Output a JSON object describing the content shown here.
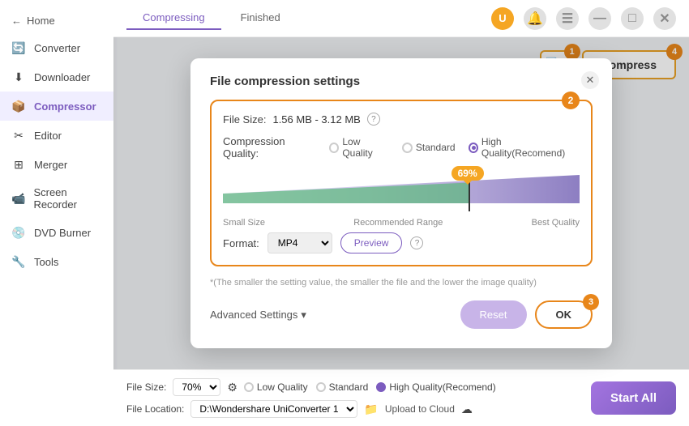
{
  "sidebar": {
    "back_label": "Home",
    "items": [
      {
        "id": "converter",
        "label": "Converter",
        "icon": "🔄",
        "active": false
      },
      {
        "id": "downloader",
        "label": "Downloader",
        "icon": "⬇",
        "active": false
      },
      {
        "id": "compressor",
        "label": "Compressor",
        "icon": "📦",
        "active": true
      },
      {
        "id": "editor",
        "label": "Editor",
        "icon": "✂",
        "active": false
      },
      {
        "id": "merger",
        "label": "Merger",
        "icon": "⊞",
        "active": false
      },
      {
        "id": "screen-recorder",
        "label": "Screen Recorder",
        "icon": "📹",
        "active": false
      },
      {
        "id": "dvd-burner",
        "label": "DVD Burner",
        "icon": "💿",
        "active": false
      },
      {
        "id": "tools",
        "label": "Tools",
        "icon": "🔧",
        "active": false
      }
    ]
  },
  "topbar": {
    "tabs": [
      {
        "id": "compressing",
        "label": "Compressing",
        "active": true
      },
      {
        "id": "finished",
        "label": "Finished",
        "active": false
      }
    ]
  },
  "action_row": {
    "compress_label": "Compress",
    "step1": "1",
    "step4": "4"
  },
  "modal": {
    "title": "File compression settings",
    "step2": "2",
    "step3": "3",
    "file_size_label": "File Size:",
    "file_size_value": "1.56 MB - 3.12 MB",
    "compression_quality_label": "Compression Quality:",
    "quality_options": [
      {
        "id": "low",
        "label": "Low Quality",
        "checked": false
      },
      {
        "id": "standard",
        "label": "Standard",
        "checked": false
      },
      {
        "id": "high",
        "label": "High Quality(Recomend)",
        "checked": true
      }
    ],
    "chart": {
      "percentage": "69%",
      "label_left": "Small Size",
      "label_center": "Recommended Range",
      "label_right": "Best Quality"
    },
    "format_label": "Format:",
    "format_value": "MP4",
    "preview_label": "Preview",
    "hint": "*(The smaller the setting value, the smaller the file and the lower the image quality)",
    "advanced_settings_label": "Advanced Settings",
    "reset_label": "Reset",
    "ok_label": "OK"
  },
  "bottom_bar": {
    "file_size_label": "File Size:",
    "file_size_value": "70%",
    "quality_options": [
      {
        "id": "low",
        "label": "Low Quality",
        "checked": false
      },
      {
        "id": "standard",
        "label": "Standard",
        "checked": false
      },
      {
        "id": "high",
        "label": "High Quality(Recomend)",
        "checked": true
      }
    ],
    "file_location_label": "File Location:",
    "file_location_value": "D:\\Wondershare UniConverter 1",
    "upload_label": "Upload to Cloud",
    "start_all_label": "Start All"
  }
}
